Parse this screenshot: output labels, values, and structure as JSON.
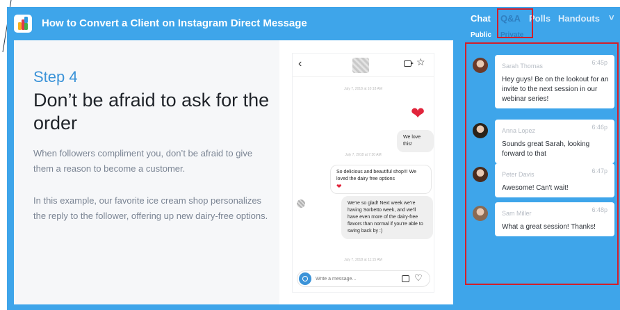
{
  "header": {
    "title": "How to Convert a Client on Instagram Direct Message"
  },
  "slide": {
    "step": "Step 4",
    "headline": "Don’t be afraid to ask for the order",
    "paragraph_1": "When followers compliment you, don’t be afraid to give them a reason to become a customer.",
    "paragraph_2": "In this example, our favorite ice cream shop personalizes the reply to the follower, offering up new dairy-free options."
  },
  "phone": {
    "timestamp_1": "July 7, 2018 at 10:18 AM",
    "sent_message": "We love this!",
    "timestamp_2": "July 7, 2018 at 7:30 AM",
    "received_message": "So delicious and beautiful shop!!! We loved the dairy free options",
    "reply_message": "We're so glad! Next week we're having Sorbetto week, and we'll have even more of the dairy-free flavors than normal if you're able to swing back by :)",
    "timestamp_3": "July 7, 2018 at 11:15 AM",
    "composer_placeholder": "Write a message..."
  },
  "sidebar": {
    "tabs": {
      "chat": "Chat",
      "qa": "Q&A",
      "polls": "Polls",
      "handouts": "Handouts",
      "more": "˅"
    },
    "subtabs": {
      "public": "Public",
      "private": "Private"
    },
    "messages": [
      {
        "name": "Sarah Thomas",
        "time": "6:45p",
        "text": "Hey guys! Be on the lookout for an invite to the next session in our webinar series!",
        "avatar_color": "#6b3a2a"
      },
      {
        "name": "Anna Lopez",
        "time": "6:46p",
        "text": "Sounds great Sarah, looking forward to that",
        "avatar_color": "#2b2219"
      },
      {
        "name": "Peter Davis",
        "time": "6:47p",
        "text": "Awesome! Can't wait!",
        "avatar_color": "#4a2c1d"
      },
      {
        "name": "Sam Miller",
        "time": "6:48p",
        "text": "What a great session! Thanks!",
        "avatar_color": "#8a6a52"
      }
    ]
  },
  "colors": {
    "stage_blue": "#3ea5ea",
    "accent_blue": "#3b93d8",
    "heart_red": "#e1243b",
    "highlight_red": "#d21f2a"
  }
}
